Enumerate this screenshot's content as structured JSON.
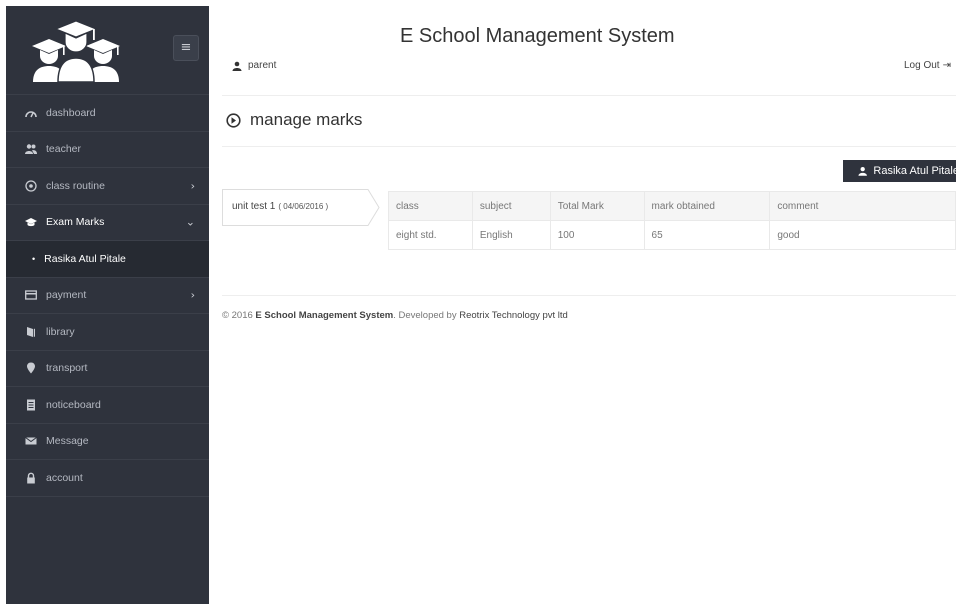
{
  "header": {
    "title": "E School Management System",
    "user": "parent",
    "logout": "Log Out"
  },
  "sidebar": {
    "toggle_icon": "hamburger-icon",
    "items": [
      {
        "label": "dashboard",
        "icon": "dashboard-gauge-icon"
      },
      {
        "label": "teacher",
        "icon": "users-icon"
      },
      {
        "label": "class routine",
        "icon": "target-icon",
        "has_chevron": true
      },
      {
        "label": "Exam Marks",
        "icon": "graduation-cap-icon",
        "expanded": true
      },
      {
        "label": "payment",
        "icon": "card-icon",
        "has_chevron": true
      },
      {
        "label": "library",
        "icon": "book-icon"
      },
      {
        "label": "transport",
        "icon": "map-marker-icon"
      },
      {
        "label": "noticeboard",
        "icon": "notice-icon"
      },
      {
        "label": "Message",
        "icon": "envelope-icon"
      },
      {
        "label": "account",
        "icon": "lock-icon"
      }
    ],
    "sub_item": {
      "label": "Rasika Atul Pitale"
    }
  },
  "page": {
    "heading": "manage marks",
    "student_button": "Rasika Atul Pitale",
    "exam_tab": {
      "label": "unit test 1",
      "date": "( 04/06/2016 )"
    }
  },
  "marks_table": {
    "headers": [
      "class",
      "subject",
      "Total Mark",
      "mark obtained",
      "comment"
    ],
    "rows": [
      [
        "eight std.",
        "English",
        "100",
        "65",
        "good"
      ]
    ]
  },
  "footer": {
    "copyright": "© 2016",
    "brand": "E School Management System",
    "developed_by": ". Developed by",
    "company": "Reotrix Technology pvt ltd"
  },
  "colors": {
    "sidebar_bg": "#2f333d",
    "sidebar_sub_bg": "#262a32",
    "button_bg": "#2f333d"
  }
}
